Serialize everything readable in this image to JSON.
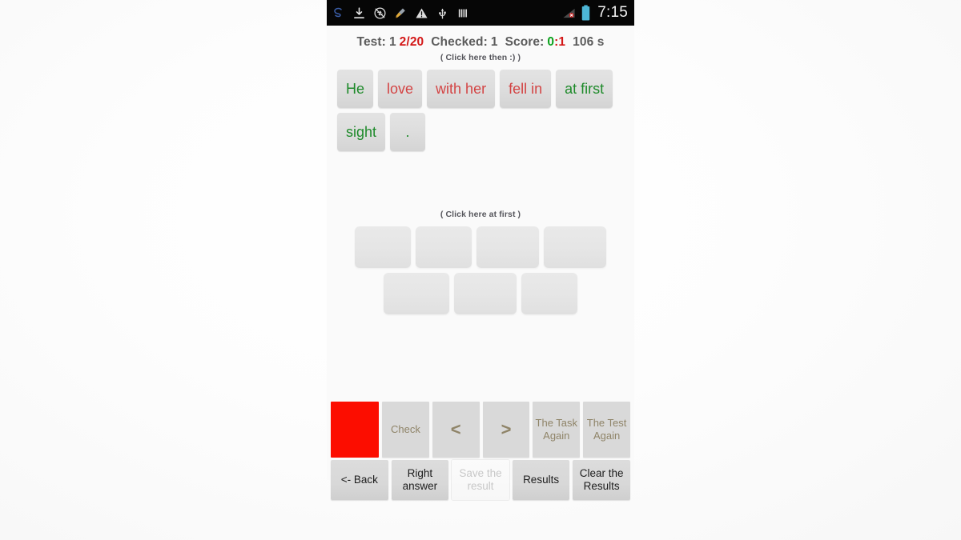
{
  "statusbar": {
    "icons": [
      {
        "name": "s-logo-icon"
      },
      {
        "name": "download-icon"
      },
      {
        "name": "sync-disabled-icon"
      },
      {
        "name": "broom-cleaner-icon"
      },
      {
        "name": "warning-icon"
      },
      {
        "name": "usb-icon"
      },
      {
        "name": "vpn-bars-icon"
      }
    ],
    "right_icons": [
      {
        "name": "signal-no-service-icon"
      },
      {
        "name": "battery-icon"
      }
    ],
    "clock": "7:15"
  },
  "header": {
    "test_label": "Test:",
    "test_number": "1",
    "progress_current": "2",
    "progress_rest": "/20",
    "checked_label": "Checked:",
    "checked_value": "1",
    "score_label": "Score:",
    "score_left": "0",
    "score_colon": ":",
    "score_right": "1",
    "time": "106 s",
    "hint": "( Click here then :) )"
  },
  "words": {
    "tiles": [
      {
        "text": "He",
        "color": "green"
      },
      {
        "text": "love",
        "color": "red"
      },
      {
        "text": "with her",
        "color": "red"
      },
      {
        "text": "fell in",
        "color": "red"
      },
      {
        "text": "at first",
        "color": "green"
      },
      {
        "text": "sight",
        "color": "green"
      },
      {
        "text": ".",
        "color": "green"
      }
    ]
  },
  "dropzone": {
    "hint": "( Click here at first )",
    "row1_slots": 4,
    "row2_slots": 3
  },
  "buttons": {
    "row1": [
      {
        "label": "",
        "name": "status-indicator-button"
      },
      {
        "label": "Check",
        "name": "check-button"
      },
      {
        "label": "<",
        "name": "previous-button"
      },
      {
        "label": ">",
        "name": "next-button"
      },
      {
        "label": "The Task\nAgain",
        "name": "task-again-button"
      },
      {
        "label": "The Test\nAgain",
        "name": "test-again-button"
      }
    ],
    "row2": [
      {
        "label": "<- Back",
        "name": "back-button"
      },
      {
        "label": "Right\nanswer",
        "name": "right-answer-button"
      },
      {
        "label": "Save the\nresult",
        "name": "save-result-button"
      },
      {
        "label": "Results",
        "name": "results-button"
      },
      {
        "label": "Clear the\nResults",
        "name": "clear-results-button"
      }
    ]
  },
  "colors": {
    "correct": "#1e8a2a",
    "incorrect": "#d34444",
    "indicator": "#fc0d00",
    "button_text": "#8f8468"
  }
}
